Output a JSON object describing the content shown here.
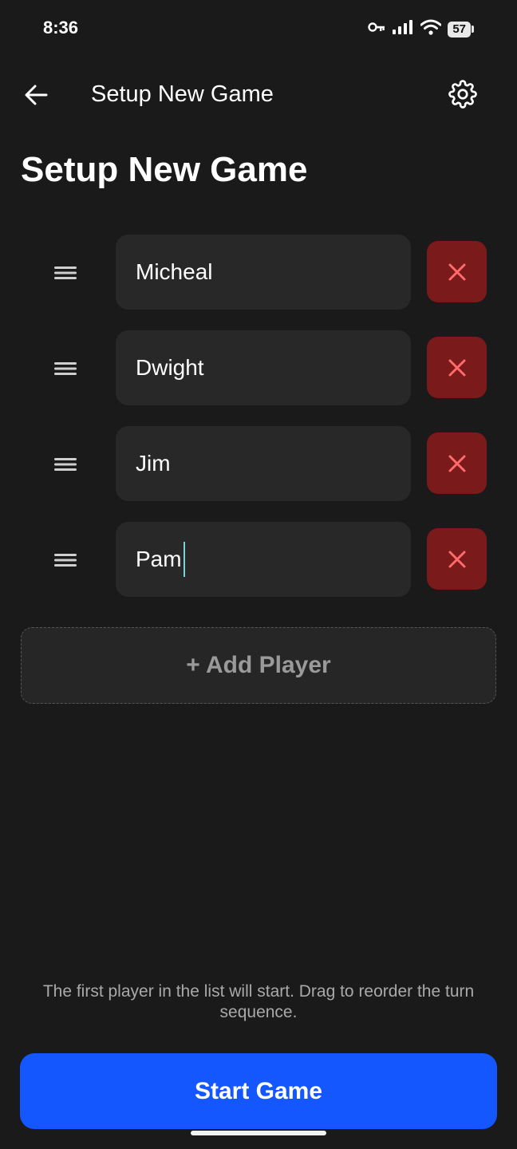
{
  "status_bar": {
    "time": "8:36",
    "battery": "57",
    "icons": [
      "key-icon",
      "signal-icon",
      "wifi-icon",
      "battery-icon"
    ]
  },
  "app_bar": {
    "title": "Setup New Game",
    "back_icon": "arrow-left-icon",
    "settings_icon": "gear-icon"
  },
  "page_title": "Setup New Game",
  "players": [
    {
      "name": "Micheal"
    },
    {
      "name": "Dwight"
    },
    {
      "name": "Jim"
    },
    {
      "name": "Pam"
    }
  ],
  "add_player_label": "+ Add Player",
  "hint_text": "The first player in the list will start. Drag to reorder the turn sequence.",
  "start_button_label": "Start Game",
  "colors": {
    "background": "#1a1a1a",
    "field": "#282828",
    "remove": "#7a1a1a",
    "remove_icon": "#ff6b6b",
    "primary": "#1557ff",
    "caret": "#7ad3d3"
  }
}
